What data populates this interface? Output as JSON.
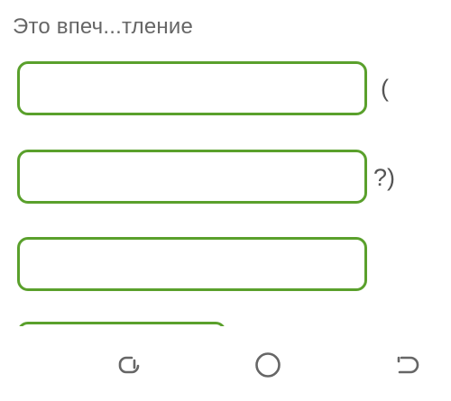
{
  "question": {
    "heading": "Это впеч...тление"
  },
  "answers": [
    {
      "value": "",
      "suffix": "("
    },
    {
      "value": "",
      "suffix": "?)"
    },
    {
      "value": "",
      "suffix": ""
    }
  ],
  "navigation": {
    "recent_icon": "recent-apps-icon",
    "home_icon": "home-icon",
    "back_icon": "back-icon"
  },
  "colors": {
    "box_border": "#5aa02c",
    "text": "#666666",
    "nav_icon": "#666666"
  }
}
